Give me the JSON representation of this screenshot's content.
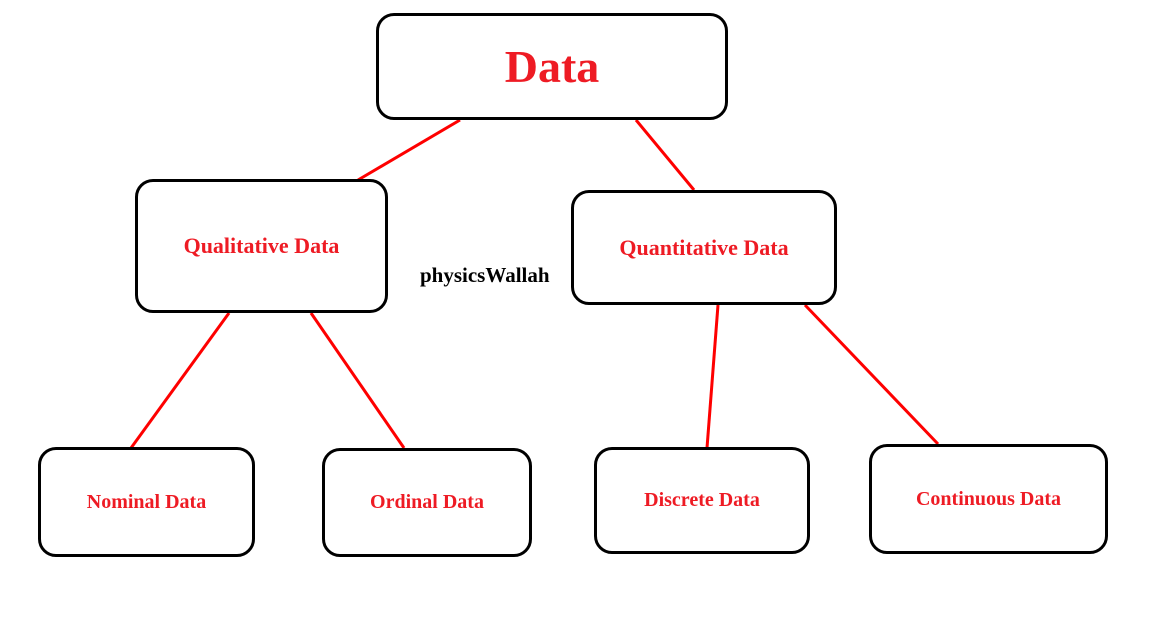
{
  "diagram": {
    "root": {
      "label": "Data"
    },
    "branches": {
      "qualitative": {
        "label": "Qualitative Data",
        "children": {
          "nominal": {
            "label": "Nominal Data"
          },
          "ordinal": {
            "label": "Ordinal Data"
          }
        }
      },
      "quantitative": {
        "label": "Quantitative Data",
        "children": {
          "discrete": {
            "label": "Discrete Data"
          },
          "continuous": {
            "label": "Continuous Data"
          }
        }
      }
    }
  },
  "watermark": "physicsWallah",
  "colors": {
    "node_border": "#000000",
    "text_red": "#ee1b24",
    "connector": "#fe0000"
  }
}
